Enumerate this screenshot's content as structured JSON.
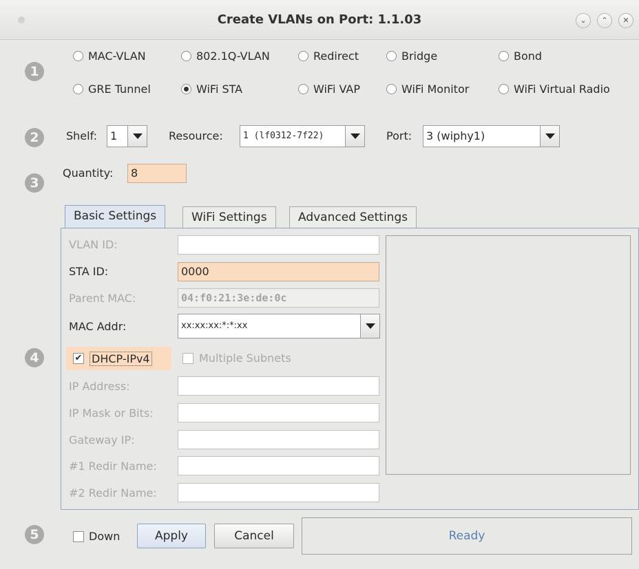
{
  "window": {
    "title": "Create VLANs on Port: 1.1.03",
    "controls": [
      "minimize",
      "maximize",
      "close"
    ]
  },
  "steps": [
    "1",
    "2",
    "3",
    "4",
    "5"
  ],
  "port_types": {
    "mac_vlan": "MAC-VLAN",
    "dot1q_vlan": "802.1Q-VLAN",
    "redirect": "Redirect",
    "bridge": "Bridge",
    "bond": "Bond",
    "gre_tunnel": "GRE Tunnel",
    "wifi_sta": "WiFi STA",
    "wifi_vap": "WiFi VAP",
    "wifi_monitor": "WiFi Monitor",
    "wifi_virtual_radio": "WiFi Virtual Radio",
    "selected": "WiFi STA"
  },
  "location": {
    "shelf_label": "Shelf:",
    "shelf_value": "1",
    "resource_label": "Resource:",
    "resource_value": "1 (lf0312-7f22)",
    "port_label": "Port:",
    "port_value": "3 (wiphy1)"
  },
  "quantity": {
    "label": "Quantity:",
    "value": "8"
  },
  "tabs": [
    "Basic Settings",
    "WiFi Settings",
    "Advanced Settings"
  ],
  "active_tab": "Basic Settings",
  "form": {
    "vlan_id": {
      "label": "VLAN ID:",
      "value": ""
    },
    "sta_id": {
      "label": "STA ID:",
      "value": "0000"
    },
    "parent_mac": {
      "label": "Parent MAC:",
      "value": "04:f0:21:3e:de:0c"
    },
    "mac_addr": {
      "label": "MAC Addr:",
      "value": "xx:xx:xx:*:*:xx"
    },
    "dhcp_ipv4": {
      "label": "DHCP-IPv4",
      "checked": true
    },
    "multiple_subnets": {
      "label": "Multiple Subnets",
      "checked": false
    },
    "ip_address": {
      "label": "IP Address:",
      "value": ""
    },
    "ip_mask": {
      "label": "IP Mask or Bits:",
      "value": ""
    },
    "gateway_ip": {
      "label": "Gateway IP:",
      "value": ""
    },
    "redir1": {
      "label": "#1 Redir Name:",
      "value": ""
    },
    "redir2": {
      "label": "#2 Redir Name:",
      "value": ""
    }
  },
  "footer": {
    "down_label": "Down",
    "down_checked": false,
    "apply_label": "Apply",
    "cancel_label": "Cancel",
    "status": "Ready"
  },
  "colors": {
    "peach_field": "#fbdcc0",
    "status_text": "#5a7fb0",
    "tab_accent": "#8fa4c0"
  }
}
